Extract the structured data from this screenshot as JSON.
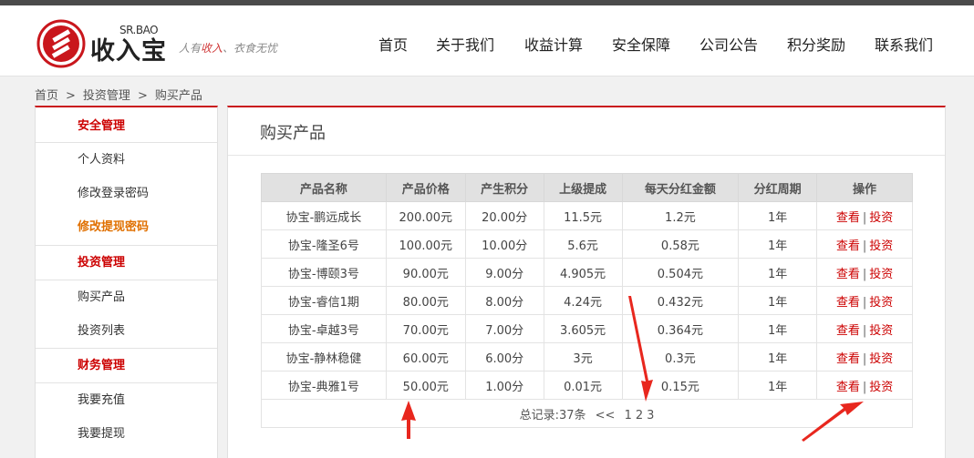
{
  "logo": {
    "small": "SR.BAO",
    "big": "收入宝",
    "slogan_a": "人有",
    "slogan_b": "收入",
    "slogan_c": "、衣食无忧"
  },
  "nav": [
    "首页",
    "关于我们",
    "收益计算",
    "安全保障",
    "公司公告",
    "积分奖励",
    "联系我们"
  ],
  "breadcrumb": [
    "首页",
    "投资管理",
    "购买产品"
  ],
  "breadcrumb_sep": ">",
  "sidebar": [
    {
      "label": "安全管理",
      "type": "group"
    },
    {
      "label": "个人资料",
      "type": "link"
    },
    {
      "label": "修改登录密码",
      "type": "link"
    },
    {
      "label": "修改提现密码",
      "type": "active"
    },
    {
      "label": "投资管理",
      "type": "group"
    },
    {
      "label": "购买产品",
      "type": "link"
    },
    {
      "label": "投资列表",
      "type": "link"
    },
    {
      "label": "财务管理",
      "type": "group"
    },
    {
      "label": "我要充值",
      "type": "link"
    },
    {
      "label": "我要提现",
      "type": "link"
    }
  ],
  "panel_title": "购买产品",
  "table": {
    "headers": [
      "产品名称",
      "产品价格",
      "产生积分",
      "上级提成",
      "每天分红金额",
      "分红周期",
      "操作"
    ],
    "rows": [
      [
        "协宝-鹏远成长",
        "200.00元",
        "20.00分",
        "11.5元",
        "1.2元",
        "1年"
      ],
      [
        "协宝-隆圣6号",
        "100.00元",
        "10.00分",
        "5.6元",
        "0.58元",
        "1年"
      ],
      [
        "协宝-博颐3号",
        "90.00元",
        "9.00分",
        "4.905元",
        "0.504元",
        "1年"
      ],
      [
        "协宝-睿信1期",
        "80.00元",
        "8.00分",
        "4.24元",
        "0.432元",
        "1年"
      ],
      [
        "协宝-卓越3号",
        "70.00元",
        "7.00分",
        "3.605元",
        "0.364元",
        "1年"
      ],
      [
        "协宝-静林稳健",
        "60.00元",
        "6.00分",
        "3元",
        "0.3元",
        "1年"
      ],
      [
        "协宝-典雅1号",
        "50.00元",
        "1.00分",
        "0.01元",
        "0.15元",
        "1年"
      ]
    ],
    "view_label": "查看",
    "sep": "|",
    "invest_label": "投资"
  },
  "pager": {
    "total": "总记录:37条",
    "prev": "<<",
    "pages": [
      "1",
      "2",
      "3"
    ]
  },
  "colors": {
    "accent": "#c9161c",
    "link_red": "#cc0000",
    "active_orange": "#e07000",
    "annotation_arrow": "#e8271e"
  }
}
